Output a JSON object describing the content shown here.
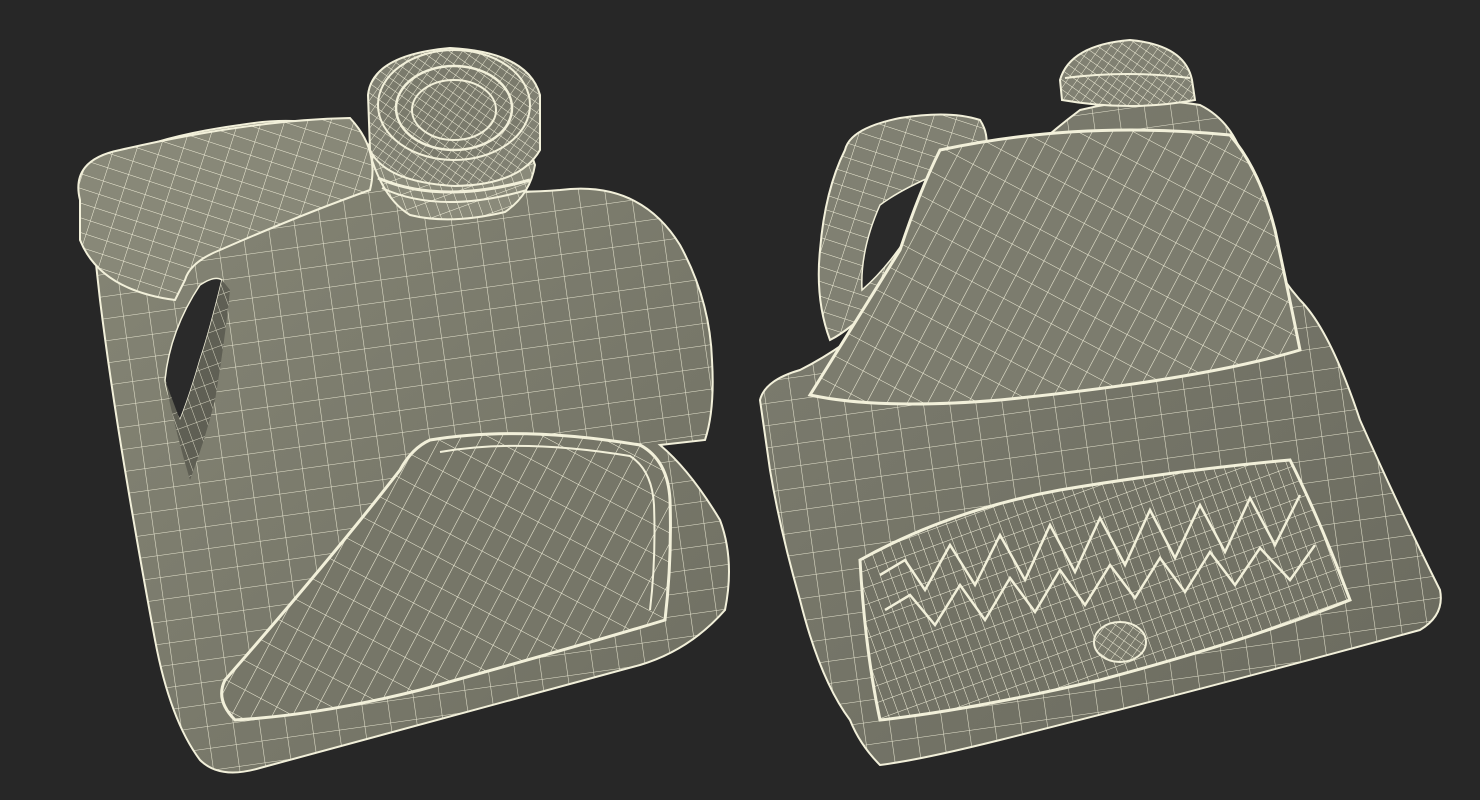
{
  "scene": {
    "background_color": "#272727",
    "surface_color": "#7c7c6d",
    "surface_shade_color": "#5f5f54",
    "wire_color": "#f2f0da",
    "views": [
      {
        "name": "front-three-quarter-view",
        "object": "plastic-jug",
        "render_style": "wireframe-over-shaded"
      },
      {
        "name": "bottom-three-quarter-view",
        "object": "plastic-jug",
        "render_style": "wireframe-over-shaded"
      }
    ]
  }
}
